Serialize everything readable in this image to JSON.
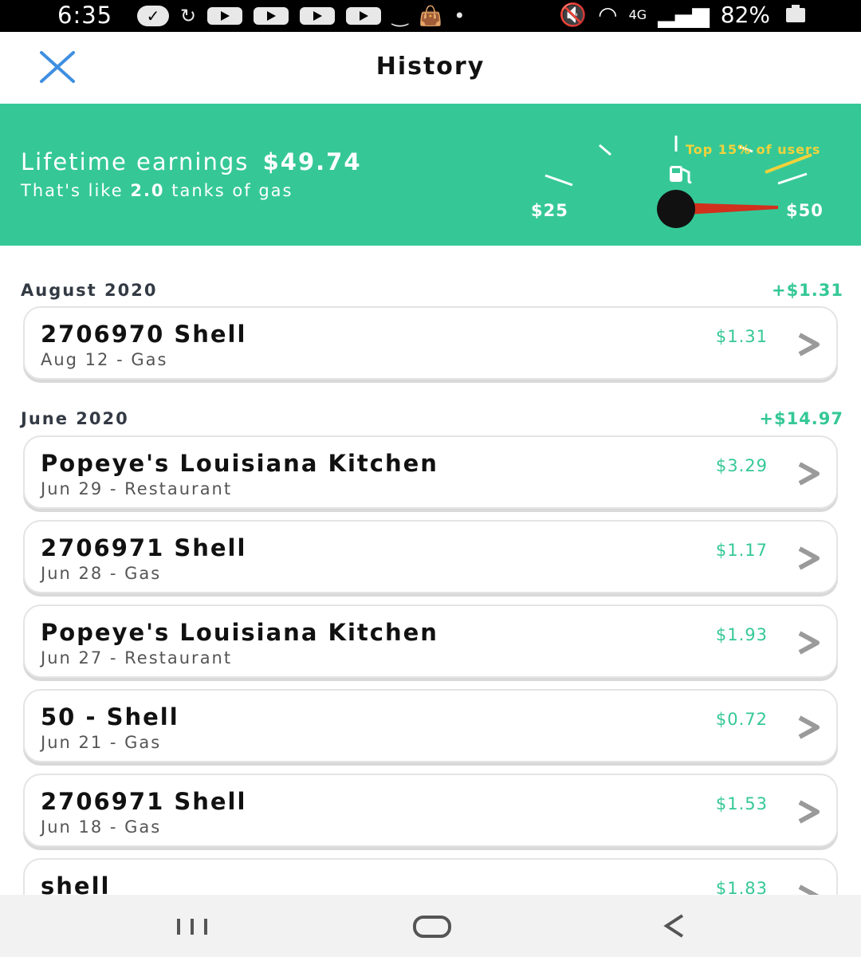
{
  "status_bar": {
    "time": "6:35",
    "network": "4G",
    "battery": "82%"
  },
  "header": {
    "title": "History",
    "close_icon": "close-icon"
  },
  "banner": {
    "lifetime_label": "Lifetime earnings",
    "lifetime_amount": "$49.74",
    "tanks_prefix": "That's like",
    "tanks_count": "2.0",
    "tanks_suffix": "tanks of gas",
    "gauge_min": "$25",
    "gauge_max": "$50",
    "top_users": "Top 15% of users",
    "gauge_icon": "gas-pump-icon",
    "color_bg": "#35c896",
    "color_needle": "#d0311d"
  },
  "sections": [
    {
      "month": "August 2020",
      "total": "+$1.31",
      "items": [
        {
          "name": "2706970 Shell",
          "sub": "Aug 12 - Gas",
          "amount": "$1.31"
        }
      ]
    },
    {
      "month": "June 2020",
      "total": "+$14.97",
      "items": [
        {
          "name": "Popeye's Louisiana Kitchen",
          "sub": "Jun 29 - Restaurant",
          "amount": "$3.29"
        },
        {
          "name": "2706971 Shell",
          "sub": "Jun 28 - Gas",
          "amount": "$1.17"
        },
        {
          "name": "Popeye's Louisiana Kitchen",
          "sub": "Jun 27 - Restaurant",
          "amount": "$1.93"
        },
        {
          "name": "50 - Shell",
          "sub": "Jun 21 - Gas",
          "amount": "$0.72"
        },
        {
          "name": "2706971 Shell",
          "sub": "Jun 18 - Gas",
          "amount": "$1.53"
        },
        {
          "name": "shell",
          "sub": "",
          "amount": "$1.83"
        }
      ]
    }
  ],
  "navbar": {
    "recents_icon": "recent-apps-icon",
    "home_icon": "home-icon",
    "back_icon": "back-icon"
  }
}
